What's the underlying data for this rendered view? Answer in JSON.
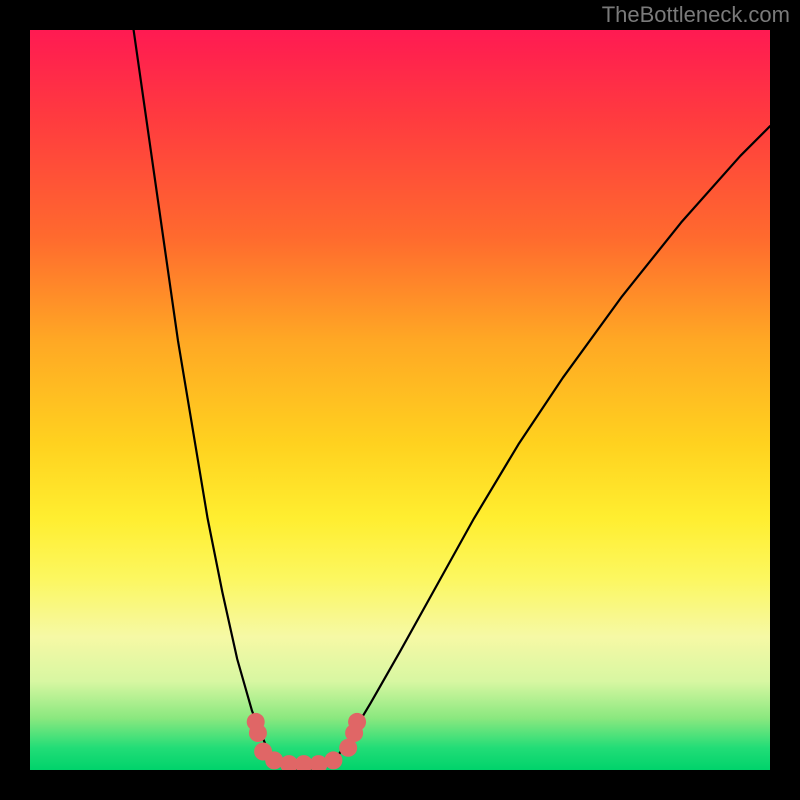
{
  "watermark": "TheBottleneck.com",
  "chart_data": {
    "type": "line",
    "title": "",
    "xlabel": "",
    "ylabel": "",
    "xlim": [
      0,
      100
    ],
    "ylim": [
      0,
      100
    ],
    "series": [
      {
        "name": "curve-left",
        "x": [
          14,
          16,
          18,
          20,
          22,
          24,
          26,
          28,
          30,
          32,
          33
        ],
        "values": [
          100,
          86,
          72,
          58,
          46,
          34,
          24,
          15,
          8,
          3,
          1
        ]
      },
      {
        "name": "curve-right",
        "x": [
          41,
          43,
          46,
          50,
          55,
          60,
          66,
          72,
          80,
          88,
          96,
          100
        ],
        "values": [
          1,
          4,
          9,
          16,
          25,
          34,
          44,
          53,
          64,
          74,
          83,
          87
        ]
      },
      {
        "name": "curve-bottom",
        "x": [
          33,
          34,
          36,
          38,
          40,
          41
        ],
        "values": [
          1,
          0.5,
          0.2,
          0.2,
          0.5,
          1
        ]
      }
    ],
    "markers": {
      "name": "dots",
      "color": "#e06666",
      "points": [
        {
          "x": 30.5,
          "y": 6.5
        },
        {
          "x": 30.8,
          "y": 5.0
        },
        {
          "x": 31.5,
          "y": 2.5
        },
        {
          "x": 33.0,
          "y": 1.3
        },
        {
          "x": 35.0,
          "y": 0.8
        },
        {
          "x": 37.0,
          "y": 0.8
        },
        {
          "x": 39.0,
          "y": 0.8
        },
        {
          "x": 41.0,
          "y": 1.3
        },
        {
          "x": 43.0,
          "y": 3.0
        },
        {
          "x": 43.8,
          "y": 5.0
        },
        {
          "x": 44.2,
          "y": 6.5
        }
      ]
    },
    "gradient_stops": [
      {
        "pct": 0,
        "color": "#ff1a52"
      },
      {
        "pct": 12,
        "color": "#ff3b3f"
      },
      {
        "pct": 28,
        "color": "#ff6a2e"
      },
      {
        "pct": 42,
        "color": "#ffa824"
      },
      {
        "pct": 56,
        "color": "#ffd21f"
      },
      {
        "pct": 66,
        "color": "#ffee30"
      },
      {
        "pct": 74,
        "color": "#fcf75f"
      },
      {
        "pct": 82,
        "color": "#f6f9a5"
      },
      {
        "pct": 88,
        "color": "#d8f7a2"
      },
      {
        "pct": 93,
        "color": "#8ae87f"
      },
      {
        "pct": 97,
        "color": "#22dd77"
      },
      {
        "pct": 100,
        "color": "#00d36b"
      }
    ]
  }
}
